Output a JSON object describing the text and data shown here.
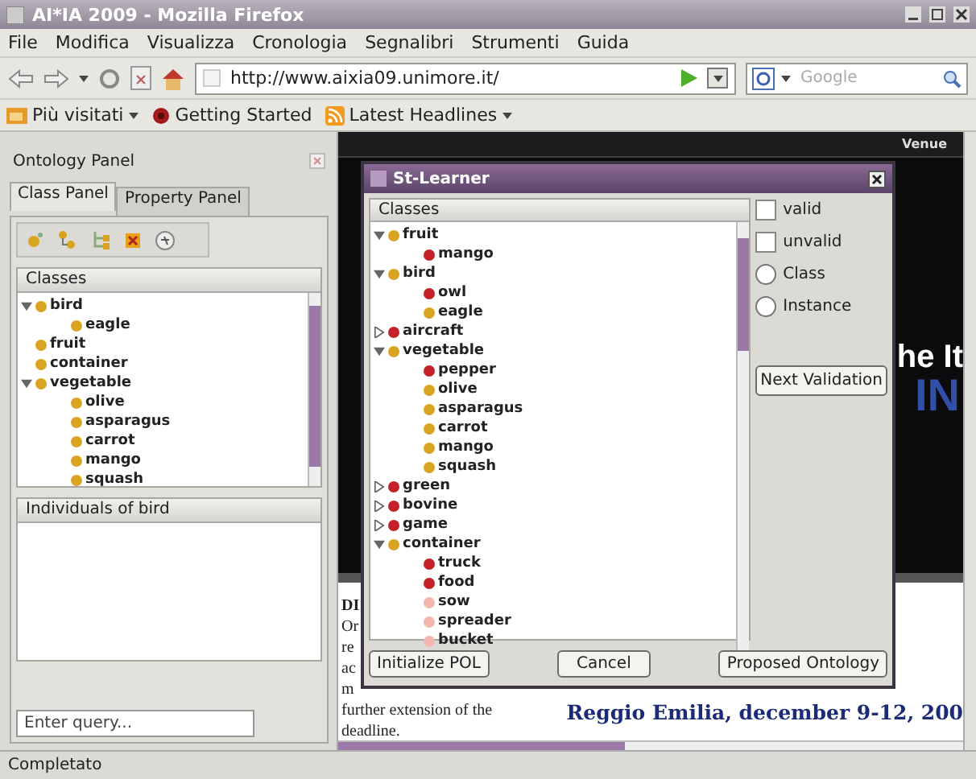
{
  "window": {
    "title": "AI*IA 2009 - Mozilla Firefox"
  },
  "menu": [
    "File",
    "Modifica",
    "Visualizza",
    "Cronologia",
    "Segnalibri",
    "Strumenti",
    "Guida"
  ],
  "url": "http://www.aixia09.unimore.it/",
  "search": {
    "placeholder": "Google"
  },
  "bookmarks": [
    {
      "label": "Più visitati",
      "kind": "folder",
      "dropdown": true
    },
    {
      "label": "Getting Started",
      "kind": "page",
      "dropdown": false
    },
    {
      "label": "Latest Headlines",
      "kind": "feed",
      "dropdown": true
    }
  ],
  "ontology_panel": {
    "title": "Ontology Panel",
    "tabs": [
      {
        "label": "Class Panel",
        "selected": true
      },
      {
        "label": "Property Panel",
        "selected": false
      }
    ],
    "classes_header": "Classes",
    "tree": [
      {
        "label": "bird",
        "color": "#d9a521",
        "expanded": true,
        "children": [
          {
            "label": "eagle",
            "color": "#d9a521"
          }
        ]
      },
      {
        "label": "fruit",
        "color": "#d9a521"
      },
      {
        "label": "container",
        "color": "#d9a521"
      },
      {
        "label": "vegetable",
        "color": "#d9a521",
        "expanded": true,
        "children": [
          {
            "label": "olive",
            "color": "#d9a521"
          },
          {
            "label": "asparagus",
            "color": "#d9a521"
          },
          {
            "label": "carrot",
            "color": "#d9a521"
          },
          {
            "label": "mango",
            "color": "#d9a521"
          },
          {
            "label": "squash",
            "color": "#d9a521"
          }
        ]
      }
    ],
    "individuals_header": "Individuals of bird",
    "query": {
      "placeholder": "Enter query..."
    }
  },
  "web_page": {
    "nav": [
      "Venue"
    ],
    "banner": [
      "he It",
      "IN"
    ],
    "text_lines": [
      "DI",
      "Or",
      "re",
      "ac",
      "m",
      "further extension of the",
      "deadline."
    ],
    "tagline": "Reggio Emilia, december 9-12, 200"
  },
  "dialog": {
    "title": "St-Learner",
    "classes_header": "Classes",
    "tree": [
      {
        "label": "fruit",
        "color": "#d9a521",
        "expanded": true,
        "children": [
          {
            "label": "mango",
            "color": "#c4202a"
          }
        ]
      },
      {
        "label": "bird",
        "color": "#d9a521",
        "expanded": true,
        "children": [
          {
            "label": "owl",
            "color": "#c4202a"
          },
          {
            "label": "eagle",
            "color": "#d9a521"
          }
        ]
      },
      {
        "label": "aircraft",
        "color": "#c4202a",
        "expanded": false
      },
      {
        "label": "vegetable",
        "color": "#d9a521",
        "expanded": true,
        "children": [
          {
            "label": "pepper",
            "color": "#c4202a"
          },
          {
            "label": "olive",
            "color": "#d9a521"
          },
          {
            "label": "asparagus",
            "color": "#d9a521"
          },
          {
            "label": "carrot",
            "color": "#d9a521"
          },
          {
            "label": "mango",
            "color": "#d9a521"
          },
          {
            "label": "squash",
            "color": "#d9a521"
          }
        ]
      },
      {
        "label": "green",
        "color": "#c4202a",
        "expanded": false
      },
      {
        "label": "bovine",
        "color": "#c4202a",
        "expanded": false
      },
      {
        "label": "game",
        "color": "#c4202a",
        "expanded": false
      },
      {
        "label": "container",
        "color": "#d9a521",
        "expanded": true,
        "children": [
          {
            "label": "truck",
            "color": "#c4202a"
          },
          {
            "label": "food",
            "color": "#c4202a"
          },
          {
            "label": "sow",
            "color": "#f2b8b0"
          },
          {
            "label": "spreader",
            "color": "#f2b8b0"
          },
          {
            "label": "bucket",
            "color": "#f2b8b0"
          }
        ]
      }
    ],
    "checkboxes": [
      {
        "label": "valid",
        "checked": false
      },
      {
        "label": "unvalid",
        "checked": false
      }
    ],
    "radios": [
      {
        "label": "Class",
        "selected": false
      },
      {
        "label": "Instance",
        "selected": false
      }
    ],
    "next_button": "Next Validation",
    "buttons": [
      "Initialize POL",
      "Cancel",
      "Proposed Ontology"
    ]
  },
  "status_bar": "Completato"
}
